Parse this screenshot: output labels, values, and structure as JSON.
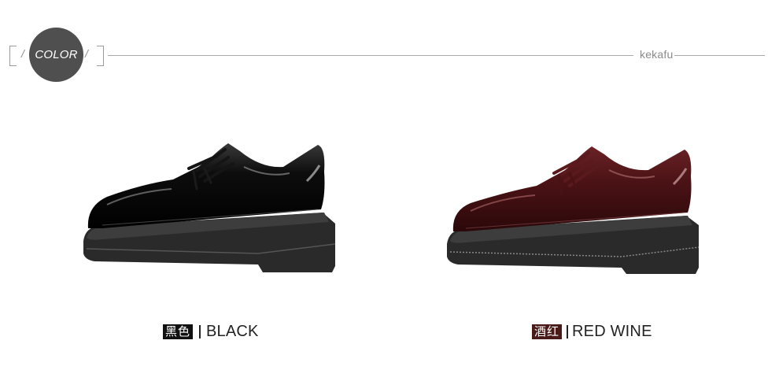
{
  "header": {
    "badge_label": "COLOR",
    "slash_left": "/",
    "slash_right": "/",
    "brand": "kekafu"
  },
  "products": [
    {
      "cn_label": "黑色",
      "en_label": "BLACK",
      "tag_color": "#111111",
      "upper_color": "#0b0b0b"
    },
    {
      "cn_label": "酒红",
      "en_label": "RED WINE",
      "tag_color": "#4a1a18",
      "upper_color": "#4b1214"
    }
  ]
}
